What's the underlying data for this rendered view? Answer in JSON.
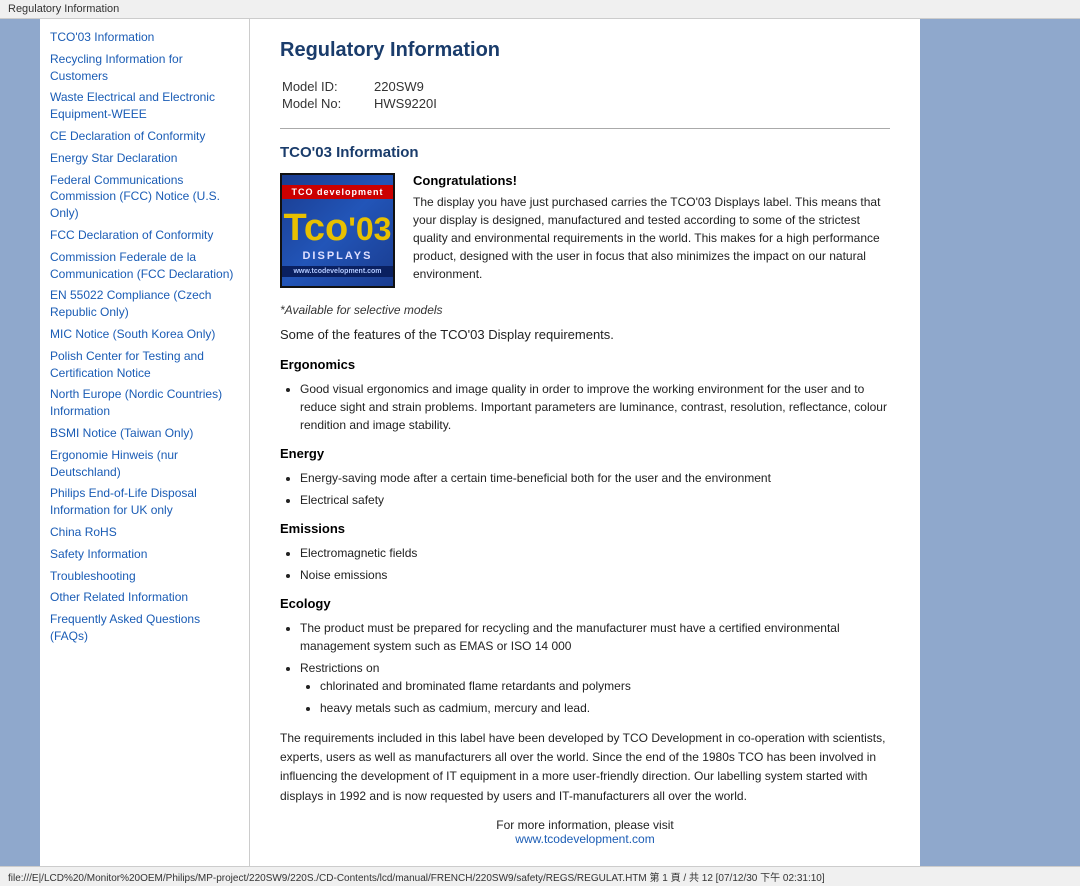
{
  "titleBar": {
    "text": "Regulatory Information"
  },
  "sidebar": {
    "links": [
      {
        "label": "TCO'03 Information",
        "id": "tco03-info"
      },
      {
        "label": "Recycling Information for Customers",
        "id": "recycling-info"
      },
      {
        "label": "Waste Electrical and Electronic Equipment-WEEE",
        "id": "weee"
      },
      {
        "label": "CE Declaration of Conformity",
        "id": "ce-declaration"
      },
      {
        "label": "Energy Star Declaration",
        "id": "energy-star"
      },
      {
        "label": "Federal Communications Commission (FCC) Notice (U.S. Only)",
        "id": "fcc-notice"
      },
      {
        "label": "FCC Declaration of Conformity",
        "id": "fcc-declaration"
      },
      {
        "label": "Commission Federale de la Communication (FCC Declaration)",
        "id": "commission-federale"
      },
      {
        "label": "EN 55022 Compliance (Czech Republic Only)",
        "id": "en55022"
      },
      {
        "label": "MIC Notice (South Korea Only)",
        "id": "mic-notice"
      },
      {
        "label": "Polish Center for Testing and Certification Notice",
        "id": "polish-center"
      },
      {
        "label": "North Europe (Nordic Countries) Information",
        "id": "north-europe"
      },
      {
        "label": "BSMI Notice (Taiwan Only)",
        "id": "bsmi-notice"
      },
      {
        "label": "Ergonomie Hinweis (nur Deutschland)",
        "id": "ergonomie-hinweis"
      },
      {
        "label": "Philips End-of-Life Disposal Information for UK only",
        "id": "philips-disposal"
      },
      {
        "label": "China RoHS",
        "id": "china-rohs"
      },
      {
        "label": "Safety Information",
        "id": "safety-info"
      },
      {
        "label": "Troubleshooting",
        "id": "troubleshooting"
      },
      {
        "label": "Other Related Information",
        "id": "other-related"
      },
      {
        "label": "Frequently Asked Questions (FAQs)",
        "id": "faqs"
      }
    ]
  },
  "main": {
    "pageTitle": "Regulatory Information",
    "modelId": {
      "label": "Model ID:",
      "value": "220SW9"
    },
    "modelNo": {
      "label": "Model No:",
      "value": "HWS9220I"
    },
    "sectionTitle": "TCO'03 Information",
    "tcoLogo": {
      "topText": "TCO development",
      "midText": "Tco",
      "numText": "'03",
      "displaysText": "DISPLAYS",
      "urlText": "www.tcodevelopment.com"
    },
    "congratsTitle": "Congratulations!",
    "congratsText": "The display you have just purchased carries the TCO'03 Displays label. This means that your display is designed, manufactured and tested according to some of the strictest quality and environmental requirements in the world. This makes for a high performance product, designed with the user in focus that also minimizes the impact on our natural environment.",
    "italicNote": "*Available for selective models",
    "featuresIntro": "Some of the features of the TCO'03 Display requirements.",
    "sections": [
      {
        "title": "Ergonomics",
        "bullets": [
          "Good visual ergonomics and image quality in order to improve the working environment for the user and to reduce sight and strain problems. Important parameters are luminance, contrast, resolution, reflectance, colour rendition and image stability."
        ]
      },
      {
        "title": "Energy",
        "bullets": [
          "Energy-saving mode after a certain time-beneficial both for the user and the environment",
          "Electrical safety"
        ]
      },
      {
        "title": "Emissions",
        "bullets": [
          "Electromagnetic fields",
          "Noise emissions"
        ]
      },
      {
        "title": "Ecology",
        "bullets": [
          "The product must be prepared for recycling and the manufacturer must have a certified environmental management system such as EMAS or ISO 14 000",
          "Restrictions on"
        ],
        "subBullets": [
          "chlorinated and brominated flame retardants and polymers",
          "heavy metals such as cadmium, mercury and lead."
        ]
      }
    ],
    "footerText": "The requirements included in this label have been developed by TCO Development in co-operation with scientists, experts, users as well as manufacturers all over the world. Since the end of the 1980s TCO has been involved in influencing the development of IT equipment in a more user-friendly direction. Our labelling system started with displays in 1992 and is now requested by users and IT-manufacturers all over the world.",
    "footerNote": "For more information, please visit",
    "footerUrl": "www.tcodevelopment.com"
  },
  "statusBar": {
    "text": "file:///E|/LCD%20/Monitor%20OEM/Philips/MP-project/220SW9/220S./CD-Contents/lcd/manual/FRENCH/220SW9/safety/REGS/REGULAT.HTM 第 1 頁 / 共 12 [07/12/30 下午 02:31:10]"
  }
}
